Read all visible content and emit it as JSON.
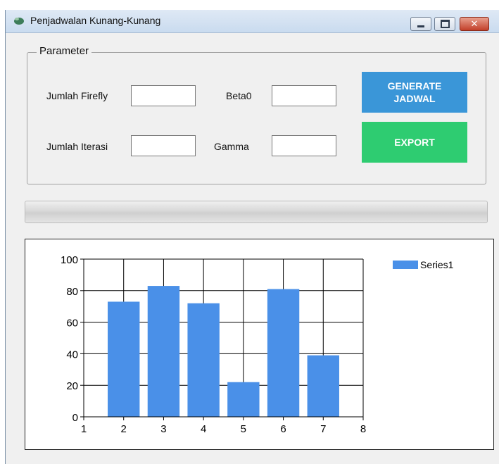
{
  "window": {
    "title": "Penjadwalan Kunang-Kunang",
    "minimize_icon": "minimize-icon",
    "maximize_icon": "maximize-icon",
    "close_icon": "close-icon",
    "app_icon": "firefly-app-icon",
    "close_glyph": "✕"
  },
  "parameter": {
    "group_title": "Parameter",
    "jumlah_firefly_label": "Jumlah Firefly",
    "jumlah_firefly_value": "",
    "beta0_label": "Beta0",
    "beta0_value": "",
    "jumlah_iterasi_label": "Jumlah Iterasi",
    "jumlah_iterasi_value": "",
    "gamma_label": "Gamma",
    "gamma_value": "",
    "generate_button": "GENERATE JADWAL",
    "export_button": "EXPORT"
  },
  "progress": {
    "value": 0
  },
  "colors": {
    "generate": "#3a96d8",
    "export": "#2ecc71",
    "bar": "#4a90e8"
  },
  "chart_data": {
    "type": "bar",
    "x": [
      2,
      3,
      4,
      5,
      6,
      7
    ],
    "series": [
      {
        "name": "Series1",
        "values": [
          73,
          83,
          72,
          22,
          81,
          39
        ]
      }
    ],
    "xlim": [
      1,
      8
    ],
    "ylim": [
      0,
      100
    ],
    "xticks": [
      1,
      2,
      3,
      4,
      5,
      6,
      7,
      8
    ],
    "yticks": [
      0,
      20,
      40,
      60,
      80,
      100
    ],
    "grid": true,
    "legend": "top-right",
    "title": "",
    "xlabel": "",
    "ylabel": ""
  }
}
